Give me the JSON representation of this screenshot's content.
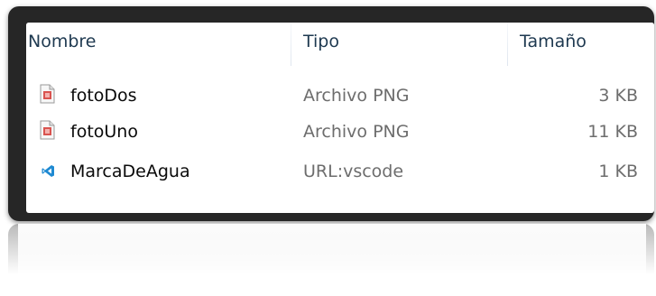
{
  "columns": {
    "name": "Nombre",
    "type": "Tipo",
    "size": "Tamaño"
  },
  "files": [
    {
      "name": "fotoDos",
      "type": "Archivo PNG",
      "size": "3 KB",
      "icon": "png-file-icon"
    },
    {
      "name": "fotoUno",
      "type": "Archivo PNG",
      "size": "11 KB",
      "icon": "png-file-icon"
    },
    {
      "name": "MarcaDeAgua",
      "type": "URL:vscode",
      "size": "1 KB",
      "icon": "vscode-icon"
    }
  ],
  "colors": {
    "frame": "#262626",
    "header_text": "#1e3950",
    "name_text": "#0a0a0a",
    "meta_text": "#6d6d6d",
    "vscode_blue": "#1f8ad2"
  }
}
